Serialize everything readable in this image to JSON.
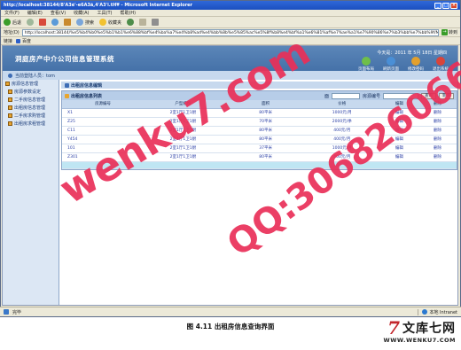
{
  "browser": {
    "title": "http://localhost:38144/8'Ã3é'-e6Ã3ã,4'Ã3'i.tH¥ - Microsoft Internet Explorer",
    "menu": [
      "文件(F)",
      "编辑(E)",
      "查看(V)",
      "收藏(A)",
      "工具(T)",
      "帮助(H)"
    ],
    "toolbar": {
      "back": "后退",
      "search": "搜索",
      "favorites": "收藏夹"
    },
    "address_label": "地址(D)",
    "address_value": "http://localhost:38144/%e5%b4%b0%e5%b1%b1%e6%88%bf%e4%ba%a7%e4%b8%ad%e4%bb%8b%e5%85%ac%e5%8f%b8%e4%bf%a1%e6%81%af%e7%ae%a1%e7%90%86%e7%b3%bb%e7%bb%9f/MainFrame.aspx",
    "go_label": "转到",
    "links_label": "链接",
    "links_item": "百度",
    "status_text": "完毕",
    "zone_text": "本地 Intranet",
    "colors": {
      "titlebar": "#1b4fbf",
      "banner": "#3d6aa3"
    }
  },
  "app": {
    "system_title": "洞庭房产中介公司信息管理系统",
    "date_text": "今天是：2011 年 5月 18日 星期四",
    "top_actions": [
      {
        "label": "页面布局",
        "icon": "layout-icon",
        "color": "#6fbf4a"
      },
      {
        "label": "刷新页面",
        "icon": "refresh-icon",
        "color": "#4a8fd6"
      },
      {
        "label": "修改密码",
        "icon": "key-icon",
        "color": "#e3a02c"
      },
      {
        "label": "退出系统",
        "icon": "exit-icon",
        "color": "#d9443a"
      }
    ],
    "user_text": "当前登陆人员：tom"
  },
  "sidebar": {
    "head": "房源信息管理",
    "items": [
      "房源参数设定",
      "二手房信息管理",
      "出租房信息管理",
      "二手房求购管理",
      "出租房求租管理"
    ]
  },
  "main": {
    "breadcrumb": "出租房信息编辑",
    "panel_title": "出租房信息列表",
    "search": {
      "label_left": "面",
      "label_right": "房源编号",
      "query_button": "查询",
      "add_button": "新增"
    },
    "table": {
      "headers": [
        "房源编号",
        "户型结构",
        "面积",
        "价格",
        "编辑",
        "删除"
      ],
      "rows": [
        [
          "X1",
          "2室1厅1卫1厨",
          "80平米",
          "1000元/月",
          "编辑",
          "删除"
        ],
        [
          "Z25",
          "2室1厅1卫1厨",
          "70平米",
          "2000元/季",
          "编辑",
          "删除"
        ],
        [
          "C11",
          "2室1厅1卫1厨",
          "80平米",
          "400元/月",
          "编辑",
          "删除"
        ],
        [
          "Y454",
          "2室1厅1卫1厨",
          "80平米",
          "400元/月",
          "编辑",
          "删除"
        ],
        [
          "101",
          "2室1厅1卫1厨",
          "37平米",
          "1000元/月",
          "编辑",
          "删除"
        ],
        [
          "Z301",
          "2室1厅1卫1厨",
          "80平米",
          "400元/月",
          "编辑",
          "删除"
        ]
      ]
    }
  },
  "caption": "图 4.11  出租房信息查询界面",
  "logo": {
    "mark": "7",
    "name": "文库七网",
    "url": "WWW.WENKU7.COM"
  },
  "watermarks": [
    "wenku7.com",
    "QQ:306826066"
  ]
}
